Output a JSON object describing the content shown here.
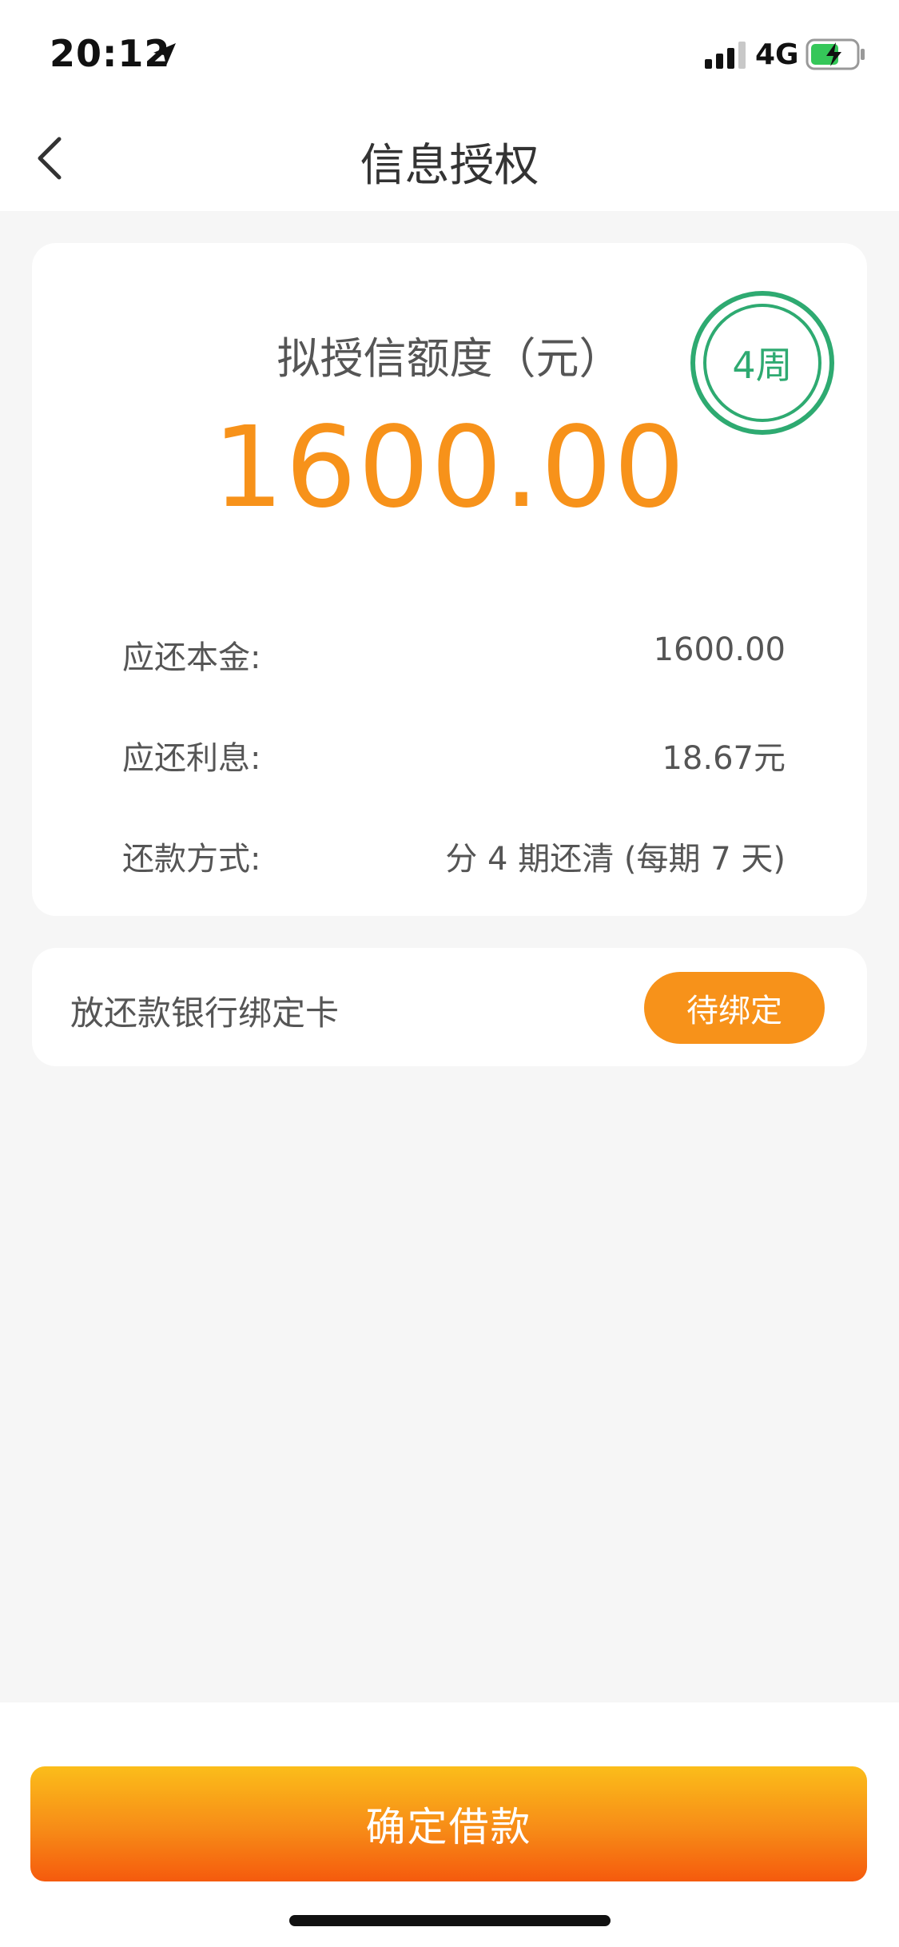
{
  "status_bar": {
    "time": "20:12",
    "network": "4G",
    "icons": [
      "location-arrow-icon",
      "signal-icon",
      "battery-charging-icon"
    ]
  },
  "nav": {
    "title": "信息授权",
    "back_icon": "chevron-left-icon"
  },
  "quota": {
    "label": "拟授信额度（元）",
    "amount": "1600.00",
    "term_badge": "4周",
    "accent_color": "#f7921a",
    "badge_color": "#2eaa71"
  },
  "details": [
    {
      "label": "应还本金:",
      "value": "1600.00"
    },
    {
      "label": "应还利息:",
      "value": "18.67元"
    },
    {
      "label": "还款方式:",
      "value": "分 4 期还清 (每期 7 天)"
    }
  ],
  "bank": {
    "label": "放还款银行绑定卡",
    "bind_button": "待绑定"
  },
  "footer": {
    "confirm_button": "确定借款"
  }
}
